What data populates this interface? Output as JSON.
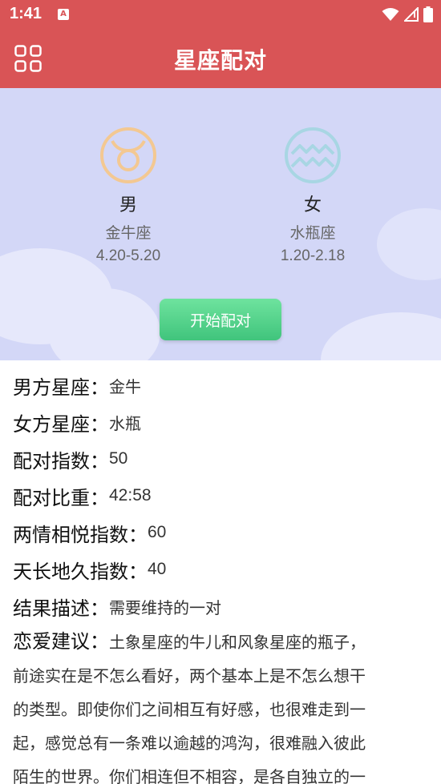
{
  "status_bar": {
    "time": "1:41",
    "notification_icon": "A"
  },
  "app_bar": {
    "title": "星座配对",
    "menu_icon": "grid-icon"
  },
  "male": {
    "gender": "男",
    "sign": "金牛座",
    "dates": "4.20-5.20",
    "symbol_icon": "taurus-icon",
    "color": "#f3c892"
  },
  "female": {
    "gender": "女",
    "sign": "水瓶座",
    "dates": "1.20-2.18",
    "symbol_icon": "aquarius-icon",
    "color": "#a8d6e3"
  },
  "start_button": "开始配对",
  "results": {
    "male_sign": {
      "label": "男方星座：",
      "value": "金牛"
    },
    "female_sign": {
      "label": "女方星座：",
      "value": "水瓶"
    },
    "match_index": {
      "label": "配对指数：",
      "value": "50"
    },
    "match_ratio": {
      "label": "配对比重：",
      "value": "42:58"
    },
    "mutual_love": {
      "label": "两情相悦指数：",
      "value": "60"
    },
    "long_lasting": {
      "label": "天长地久指数：",
      "value": "40"
    },
    "description": {
      "label": "结果描述：",
      "value": "需要维持的一对"
    },
    "advice": {
      "label": "恋爱建议：",
      "line1": "土象星座的牛儿和风象星座的瓶子，",
      "line2": "前途实在是不怎么看好，两个基本上是不怎么想干",
      "line3": "的类型。即使你们之间相互有好感，也很难走到一",
      "line4": "起，感觉总有一条难以逾越的鸿沟，很难融入彼此",
      "line5": "陌生的世界。你们相连但不相容，是各自独立的一"
    }
  },
  "colors": {
    "primary": "#d95456",
    "hero_bg": "#d3d7f7",
    "button_green": "#4fcf87"
  }
}
